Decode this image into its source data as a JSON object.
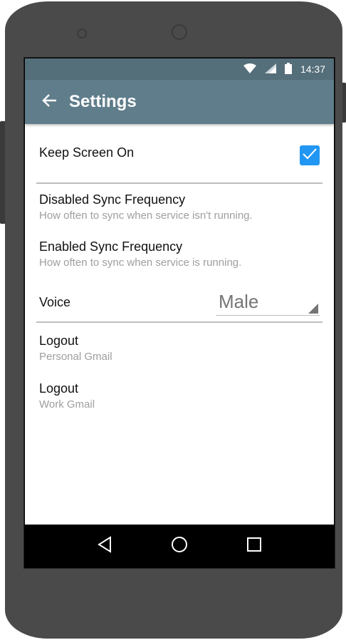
{
  "status_bar": {
    "time": "14:37",
    "icons": [
      "wifi-icon",
      "signal-icon",
      "battery-icon"
    ]
  },
  "app_bar": {
    "title": "Settings",
    "back_icon": "arrow-left-icon"
  },
  "settings": {
    "keep_screen_on": {
      "label": "Keep Screen On",
      "checked": true
    },
    "disabled_sync": {
      "label": "Disabled Sync Frequency",
      "summary": "How often to sync when service isn't running."
    },
    "enabled_sync": {
      "label": "Enabled Sync Frequency",
      "summary": "How often to sync when service is running."
    },
    "voice": {
      "label": "Voice",
      "value": "Male"
    },
    "logout_personal": {
      "label": "Logout",
      "summary": "Personal Gmail"
    },
    "logout_work": {
      "label": "Logout",
      "summary": "Work Gmail"
    }
  },
  "nav_bar": {
    "icons": [
      "back-triangle-icon",
      "home-circle-icon",
      "recents-square-icon"
    ]
  },
  "colors": {
    "status_bar": "#546e7a",
    "app_bar": "#607d8b",
    "accent": "#2196f3"
  }
}
